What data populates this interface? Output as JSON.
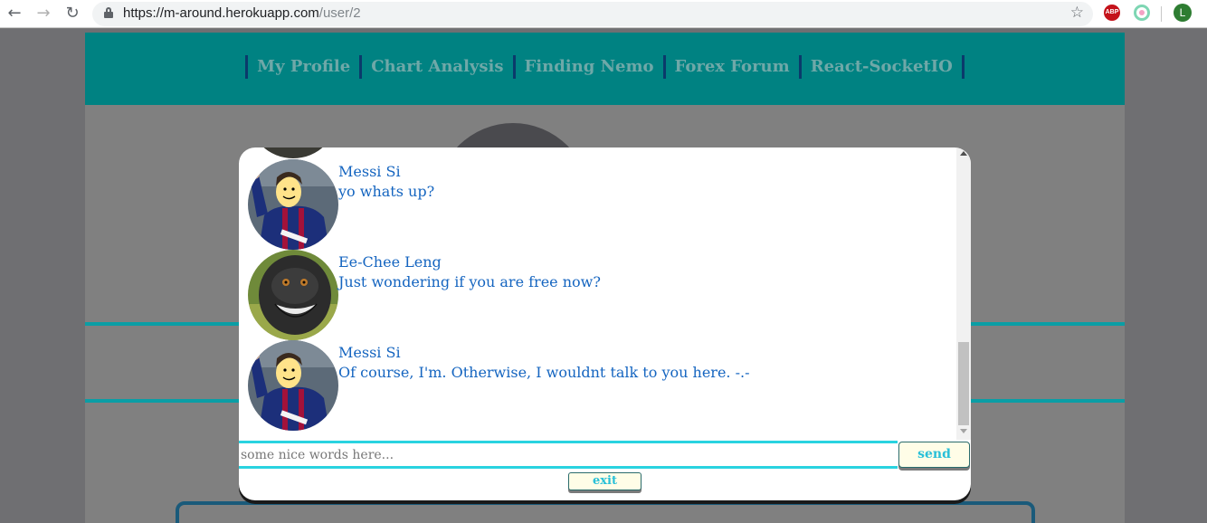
{
  "browser": {
    "url_host": "https://m-around.herokuapp.com",
    "url_path": "/user/2",
    "back_icon": "arrow-left-icon",
    "forward_icon": "arrow-right-icon",
    "reload_icon": "reload-icon",
    "bookmark_icon": "star-icon",
    "extension_abp": "ABP",
    "profile_initial": "L"
  },
  "nav": {
    "items": [
      {
        "label": "My Profile"
      },
      {
        "label": "Chart Analysis"
      },
      {
        "label": "Finding Nemo"
      },
      {
        "label": "Forex Forum"
      },
      {
        "label": "React-SocketIO"
      }
    ]
  },
  "chat": {
    "messages": [
      {
        "name": "Messi Si",
        "text": "yo whats up?",
        "avatar": "messi-avatar"
      },
      {
        "name": "Ee-Chee Leng",
        "text": "Just wondering if you are free now?",
        "avatar": "monkey-avatar"
      },
      {
        "name": "Messi Si",
        "text": "Of course, I'm. Otherwise, I wouldnt talk to you here. -.-",
        "avatar": "messi-avatar"
      }
    ],
    "input_placeholder": "some nice words here...",
    "send_label": "send",
    "exit_label": "exit"
  },
  "colors": {
    "header_teal": "#008282",
    "nav_text": "#6fa8a8",
    "message_blue": "#1565c0",
    "input_accent": "#29d3e0",
    "button_bg": "#fffde7"
  }
}
